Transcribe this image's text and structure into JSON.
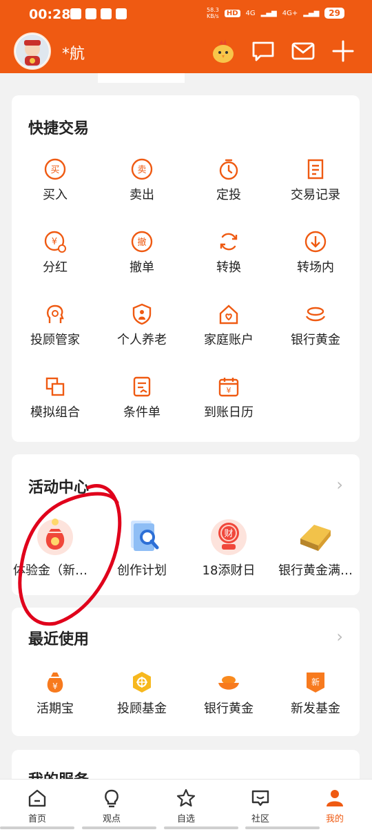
{
  "status": {
    "time": "00:28",
    "speed": "58.3\nKB/s",
    "network1": "4G",
    "network2": "4G+",
    "battery": "29"
  },
  "header": {
    "username": "*航"
  },
  "quick_trade": {
    "title": "快捷交易",
    "items": [
      {
        "label": "买入",
        "icon": "buy-icon"
      },
      {
        "label": "卖出",
        "icon": "sell-icon"
      },
      {
        "label": "定投",
        "icon": "timer-icon"
      },
      {
        "label": "交易记录",
        "icon": "record-icon"
      },
      {
        "label": "分红",
        "icon": "dividend-icon"
      },
      {
        "label": "撤单",
        "icon": "cancel-order-icon"
      },
      {
        "label": "转换",
        "icon": "convert-icon"
      },
      {
        "label": "转场内",
        "icon": "transfer-in-icon"
      },
      {
        "label": "投顾管家",
        "icon": "advisor-icon"
      },
      {
        "label": "个人养老",
        "icon": "pension-icon"
      },
      {
        "label": "家庭账户",
        "icon": "family-icon"
      },
      {
        "label": "银行黄金",
        "icon": "gold-icon"
      },
      {
        "label": "模拟组合",
        "icon": "simulate-icon"
      },
      {
        "label": "条件单",
        "icon": "condition-icon"
      },
      {
        "label": "到账日历",
        "icon": "calendar-icon"
      }
    ]
  },
  "activity": {
    "title": "活动中心",
    "items": [
      {
        "label": "体验金（新…",
        "icon": "lucky-bag-icon"
      },
      {
        "label": "创作计划",
        "icon": "create-plan-icon"
      },
      {
        "label": "18添财日",
        "icon": "wealth-day-icon"
      },
      {
        "label": "银行黄金满…",
        "icon": "gold-bar-icon"
      }
    ]
  },
  "recent": {
    "title": "最近使用",
    "items": [
      {
        "label": "活期宝",
        "icon": "money-bag-icon"
      },
      {
        "label": "投顾基金",
        "icon": "advisor-fund-icon"
      },
      {
        "label": "银行黄金",
        "icon": "gold-ingot-icon"
      },
      {
        "label": "新发基金",
        "icon": "new-fund-icon"
      }
    ]
  },
  "services": {
    "title": "我的服务"
  },
  "nav": {
    "items": [
      {
        "label": "首页"
      },
      {
        "label": "观点"
      },
      {
        "label": "自选"
      },
      {
        "label": "社区"
      },
      {
        "label": "我的"
      }
    ]
  },
  "colors": {
    "brand": "#ef5a12",
    "annotation": "#e0001b"
  }
}
